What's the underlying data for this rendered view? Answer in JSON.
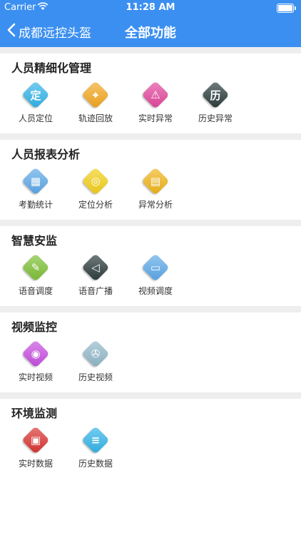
{
  "status_bar": {
    "carrier": "Carrier",
    "time": "11:28 AM"
  },
  "nav": {
    "back_label": "成都远控头盔",
    "title": "全部功能"
  },
  "sections": [
    {
      "title": "人员精细化管理",
      "items": [
        {
          "label": "人员定位",
          "icon": "location-badge-icon",
          "glyph": "定",
          "color": "#2fb3e8"
        },
        {
          "label": "轨迹回放",
          "icon": "route-pin-icon",
          "glyph": "⌖",
          "color": "#f2a61d"
        },
        {
          "label": "实时异常",
          "icon": "warning-icon",
          "glyph": "⚠",
          "color": "#e2449c"
        },
        {
          "label": "历史异常",
          "icon": "history-badge-icon",
          "glyph": "历",
          "color": "#2a3a3a"
        }
      ]
    },
    {
      "title": "人员报表分析",
      "items": [
        {
          "label": "考勤统计",
          "icon": "attendance-icon",
          "glyph": "▦",
          "color": "#5aa7e8"
        },
        {
          "label": "定位分析",
          "icon": "target-icon",
          "glyph": "◎",
          "color": "#f2cf16"
        },
        {
          "label": "异常分析",
          "icon": "report-search-icon",
          "glyph": "▤",
          "color": "#efb416"
        }
      ]
    },
    {
      "title": "智慧安监",
      "items": [
        {
          "label": "语音调度",
          "icon": "microphone-icon",
          "glyph": "✎",
          "color": "#7cbf33"
        },
        {
          "label": "语音广播",
          "icon": "speaker-icon",
          "glyph": "◁",
          "color": "#2a3a3a"
        },
        {
          "label": "视频调度",
          "icon": "monitor-icon",
          "glyph": "▭",
          "color": "#5aa7e8"
        }
      ]
    },
    {
      "title": "视频监控",
      "items": [
        {
          "label": "实时视频",
          "icon": "camera-icon",
          "glyph": "◉",
          "color": "#c64be0"
        },
        {
          "label": "历史视频",
          "icon": "film-reel-icon",
          "glyph": "✇",
          "color": "#8fb7c9"
        }
      ]
    },
    {
      "title": "环境监测",
      "items": [
        {
          "label": "实时数据",
          "icon": "presentation-chart-icon",
          "glyph": "▣",
          "color": "#d9322f"
        },
        {
          "label": "历史数据",
          "icon": "data-list-icon",
          "glyph": "≡",
          "color": "#2fb3e8"
        }
      ]
    }
  ]
}
